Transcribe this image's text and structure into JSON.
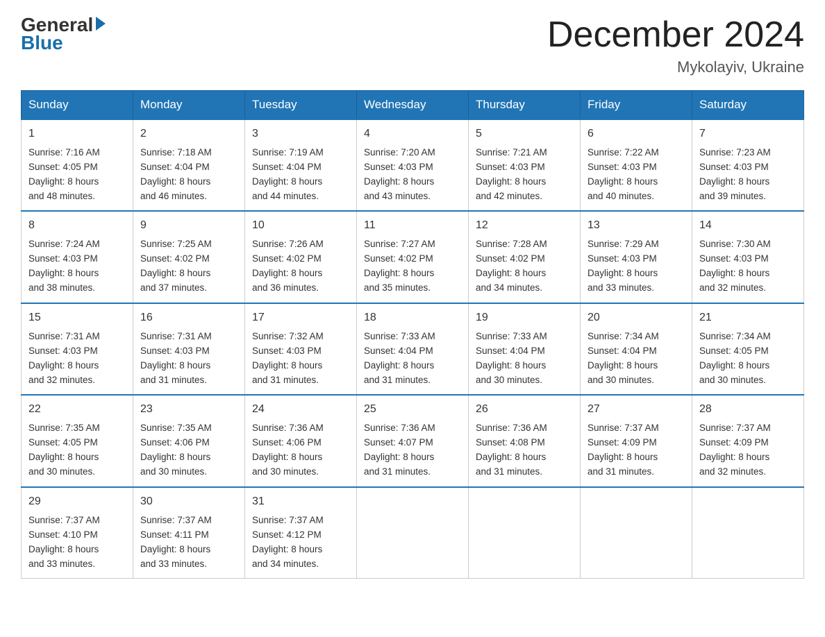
{
  "header": {
    "logo_general": "General",
    "logo_blue": "Blue",
    "month_title": "December 2024",
    "location": "Mykolayiv, Ukraine"
  },
  "days_of_week": [
    "Sunday",
    "Monday",
    "Tuesday",
    "Wednesday",
    "Thursday",
    "Friday",
    "Saturday"
  ],
  "weeks": [
    [
      {
        "day": "1",
        "sunrise": "7:16 AM",
        "sunset": "4:05 PM",
        "daylight": "8 hours and 48 minutes."
      },
      {
        "day": "2",
        "sunrise": "7:18 AM",
        "sunset": "4:04 PM",
        "daylight": "8 hours and 46 minutes."
      },
      {
        "day": "3",
        "sunrise": "7:19 AM",
        "sunset": "4:04 PM",
        "daylight": "8 hours and 44 minutes."
      },
      {
        "day": "4",
        "sunrise": "7:20 AM",
        "sunset": "4:03 PM",
        "daylight": "8 hours and 43 minutes."
      },
      {
        "day": "5",
        "sunrise": "7:21 AM",
        "sunset": "4:03 PM",
        "daylight": "8 hours and 42 minutes."
      },
      {
        "day": "6",
        "sunrise": "7:22 AM",
        "sunset": "4:03 PM",
        "daylight": "8 hours and 40 minutes."
      },
      {
        "day": "7",
        "sunrise": "7:23 AM",
        "sunset": "4:03 PM",
        "daylight": "8 hours and 39 minutes."
      }
    ],
    [
      {
        "day": "8",
        "sunrise": "7:24 AM",
        "sunset": "4:03 PM",
        "daylight": "8 hours and 38 minutes."
      },
      {
        "day": "9",
        "sunrise": "7:25 AM",
        "sunset": "4:02 PM",
        "daylight": "8 hours and 37 minutes."
      },
      {
        "day": "10",
        "sunrise": "7:26 AM",
        "sunset": "4:02 PM",
        "daylight": "8 hours and 36 minutes."
      },
      {
        "day": "11",
        "sunrise": "7:27 AM",
        "sunset": "4:02 PM",
        "daylight": "8 hours and 35 minutes."
      },
      {
        "day": "12",
        "sunrise": "7:28 AM",
        "sunset": "4:02 PM",
        "daylight": "8 hours and 34 minutes."
      },
      {
        "day": "13",
        "sunrise": "7:29 AM",
        "sunset": "4:03 PM",
        "daylight": "8 hours and 33 minutes."
      },
      {
        "day": "14",
        "sunrise": "7:30 AM",
        "sunset": "4:03 PM",
        "daylight": "8 hours and 32 minutes."
      }
    ],
    [
      {
        "day": "15",
        "sunrise": "7:31 AM",
        "sunset": "4:03 PM",
        "daylight": "8 hours and 32 minutes."
      },
      {
        "day": "16",
        "sunrise": "7:31 AM",
        "sunset": "4:03 PM",
        "daylight": "8 hours and 31 minutes."
      },
      {
        "day": "17",
        "sunrise": "7:32 AM",
        "sunset": "4:03 PM",
        "daylight": "8 hours and 31 minutes."
      },
      {
        "day": "18",
        "sunrise": "7:33 AM",
        "sunset": "4:04 PM",
        "daylight": "8 hours and 31 minutes."
      },
      {
        "day": "19",
        "sunrise": "7:33 AM",
        "sunset": "4:04 PM",
        "daylight": "8 hours and 30 minutes."
      },
      {
        "day": "20",
        "sunrise": "7:34 AM",
        "sunset": "4:04 PM",
        "daylight": "8 hours and 30 minutes."
      },
      {
        "day": "21",
        "sunrise": "7:34 AM",
        "sunset": "4:05 PM",
        "daylight": "8 hours and 30 minutes."
      }
    ],
    [
      {
        "day": "22",
        "sunrise": "7:35 AM",
        "sunset": "4:05 PM",
        "daylight": "8 hours and 30 minutes."
      },
      {
        "day": "23",
        "sunrise": "7:35 AM",
        "sunset": "4:06 PM",
        "daylight": "8 hours and 30 minutes."
      },
      {
        "day": "24",
        "sunrise": "7:36 AM",
        "sunset": "4:06 PM",
        "daylight": "8 hours and 30 minutes."
      },
      {
        "day": "25",
        "sunrise": "7:36 AM",
        "sunset": "4:07 PM",
        "daylight": "8 hours and 31 minutes."
      },
      {
        "day": "26",
        "sunrise": "7:36 AM",
        "sunset": "4:08 PM",
        "daylight": "8 hours and 31 minutes."
      },
      {
        "day": "27",
        "sunrise": "7:37 AM",
        "sunset": "4:09 PM",
        "daylight": "8 hours and 31 minutes."
      },
      {
        "day": "28",
        "sunrise": "7:37 AM",
        "sunset": "4:09 PM",
        "daylight": "8 hours and 32 minutes."
      }
    ],
    [
      {
        "day": "29",
        "sunrise": "7:37 AM",
        "sunset": "4:10 PM",
        "daylight": "8 hours and 33 minutes."
      },
      {
        "day": "30",
        "sunrise": "7:37 AM",
        "sunset": "4:11 PM",
        "daylight": "8 hours and 33 minutes."
      },
      {
        "day": "31",
        "sunrise": "7:37 AM",
        "sunset": "4:12 PM",
        "daylight": "8 hours and 34 minutes."
      },
      null,
      null,
      null,
      null
    ]
  ],
  "labels": {
    "sunrise_prefix": "Sunrise: ",
    "sunset_prefix": "Sunset: ",
    "daylight_prefix": "Daylight: "
  }
}
